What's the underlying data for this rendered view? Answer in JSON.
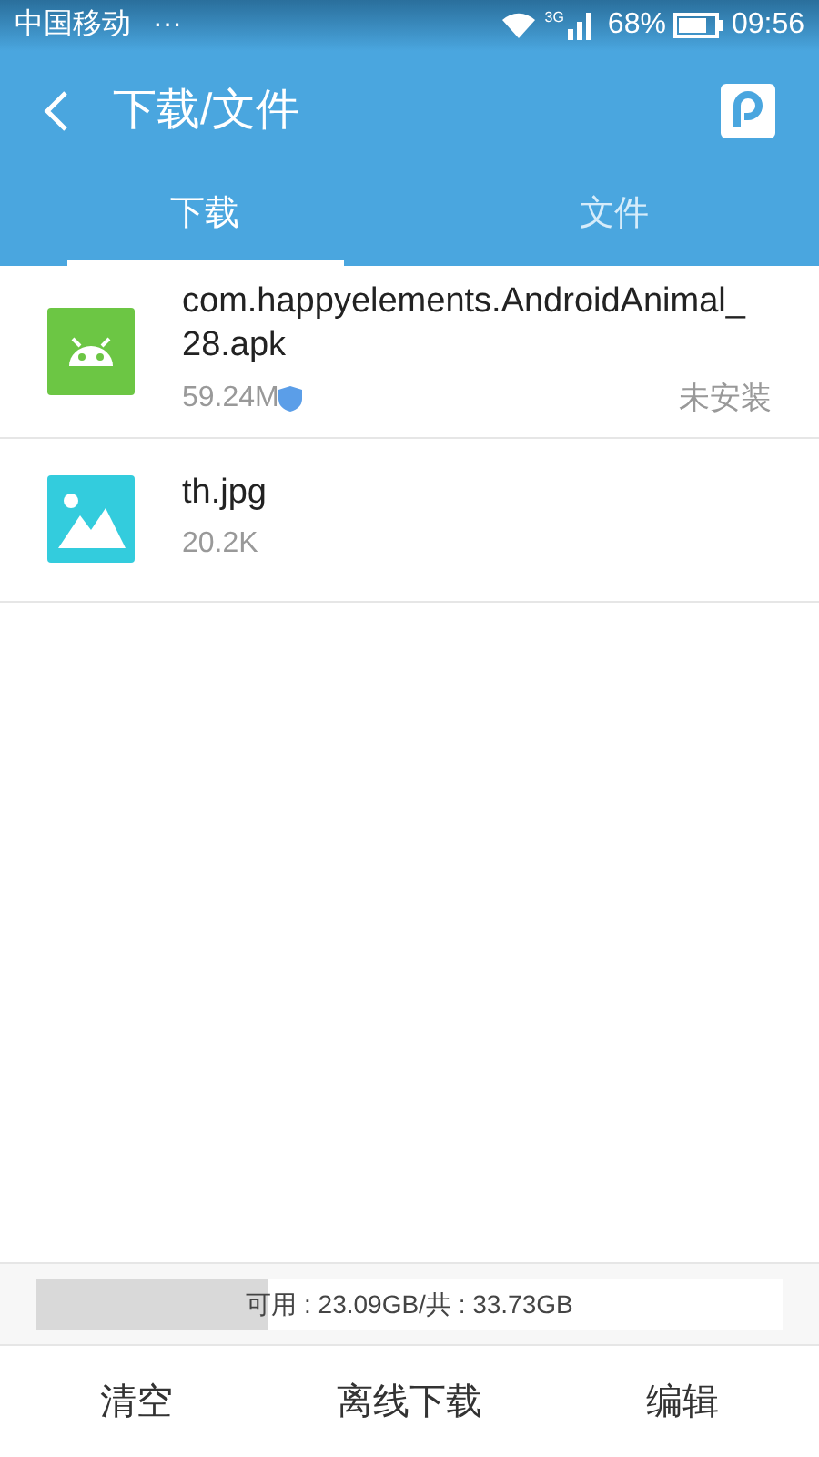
{
  "status_bar": {
    "carrier": "中国移动",
    "network": "3G",
    "battery": "68%",
    "time": "09:56",
    "more": "···"
  },
  "header": {
    "title": "下载/文件"
  },
  "tabs": [
    {
      "label": "下载",
      "selected": true
    },
    {
      "label": "文件",
      "selected": false
    }
  ],
  "files": [
    {
      "kind": "apk",
      "name": "com.happyelements.AndroidAnimal_28.apk",
      "size": "59.24M",
      "status": "未安装"
    },
    {
      "kind": "image",
      "name": "th.jpg",
      "size": "20.2K"
    }
  ],
  "storage": {
    "level": 0.31,
    "text": "可用 : 23.09GB/共 : 33.73GB"
  },
  "actions": [
    "清空",
    "离线下载",
    "编辑"
  ]
}
